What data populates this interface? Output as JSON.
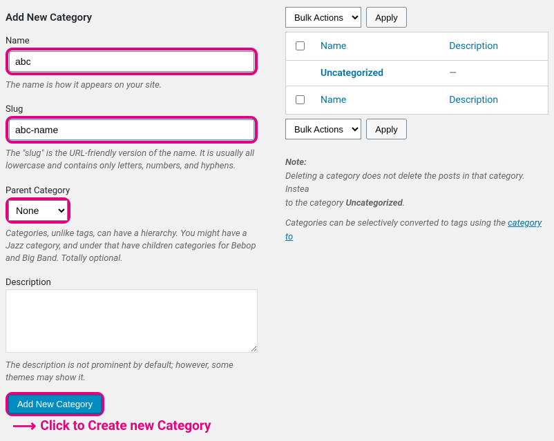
{
  "left": {
    "heading": "Add New Category",
    "name": {
      "label": "Name",
      "value": "abc",
      "help": "The name is how it appears on your site."
    },
    "slug": {
      "label": "Slug",
      "value": "abc-name",
      "help": "The \"slug\" is the URL-friendly version of the name. It is usually all lowercase and contains only letters, numbers, and hyphens."
    },
    "parent": {
      "label": "Parent Category",
      "selected": "None",
      "help": "Categories, unlike tags, can have a hierarchy. You might have a Jazz category, and under that have children categories for Bebop and Big Band. Totally optional."
    },
    "description": {
      "label": "Description",
      "value": "",
      "help": "The description is not prominent by default; however, some themes may show it."
    },
    "submit": "Add New Category",
    "annotation": "Click to Create new Category"
  },
  "right": {
    "bulk": {
      "label": "Bulk Actions",
      "apply": "Apply"
    },
    "columns": {
      "name": "Name",
      "description": "Description"
    },
    "rows": [
      {
        "name": "Uncategorized",
        "description": "—"
      }
    ],
    "note": {
      "lead": "Note:",
      "line1": {
        "prefix": "Deleting a category does not delete the posts in that category. Instea",
        "cat_prefix": "to the category ",
        "cat_name": "Uncategorized",
        "cat_suffix": "."
      },
      "line2": {
        "text": "Categories can be selectively converted to tags using the ",
        "link": "category to "
      }
    }
  }
}
